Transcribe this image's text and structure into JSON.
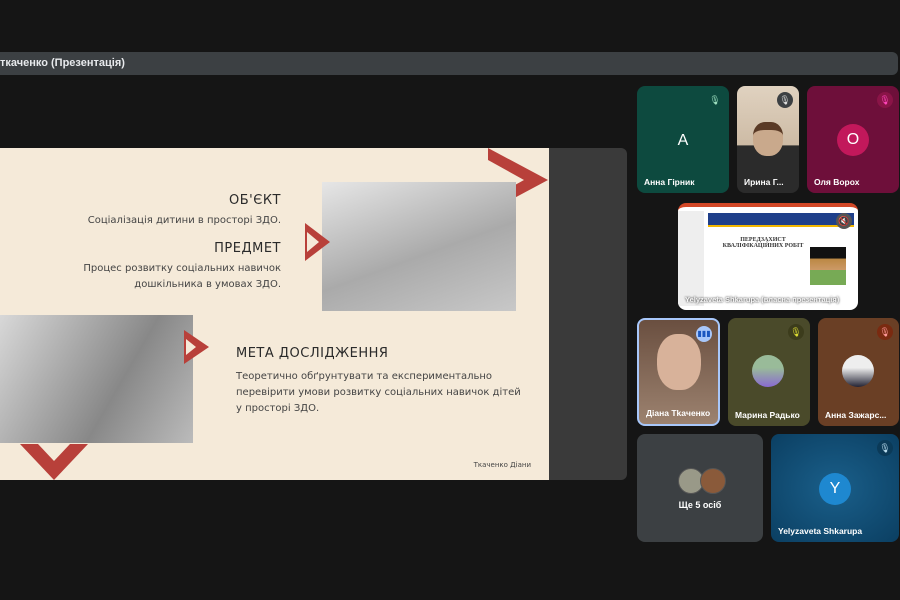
{
  "topbar": {
    "title": "ткаченко (Презентація)"
  },
  "slide": {
    "object_heading": "ОБ'ЄКТ",
    "object_text": "Соціалізація дитини в просторі ЗДО.",
    "subject_heading": "ПРЕДМЕТ",
    "subject_text_1": "Процес розвитку соціальних навичок",
    "subject_text_2": "дошкільника в умовах ЗДО.",
    "goal_heading": "МЕТА ДОСЛІДЖЕННЯ",
    "goal_text_1": "Теоретично обґрунтувати та експериментально",
    "goal_text_2": "перевірити умови розвитку соціальних навичок дітей",
    "goal_text_3": "у просторі ЗДО.",
    "footer": "Ткаченко Діани",
    "accent": "#b8403a"
  },
  "participants": [
    {
      "name": "Анна Гірник",
      "initial": "А",
      "bg": "#0d4a3f"
    },
    {
      "name": "Ирина Г..."
    },
    {
      "name": "Оля Ворох",
      "initial": "О",
      "bg": "#7a1040"
    },
    {
      "name": "Yelyzaveta Shkarupa (власна презентація)",
      "thumb_title": "ПЕРЕДЗАХИСТ КВАЛІФІКАЦІЙНИХ РОБІТ"
    },
    {
      "name": "Діана Тkaченко"
    },
    {
      "name": "Марина Радько"
    },
    {
      "name": "Анна Зажарс..."
    },
    {
      "name": "Ще 5 осіб"
    },
    {
      "name": "Yelyzaveta Shkarupa",
      "initial": "Y",
      "bg": "#0b4a6e"
    }
  ]
}
